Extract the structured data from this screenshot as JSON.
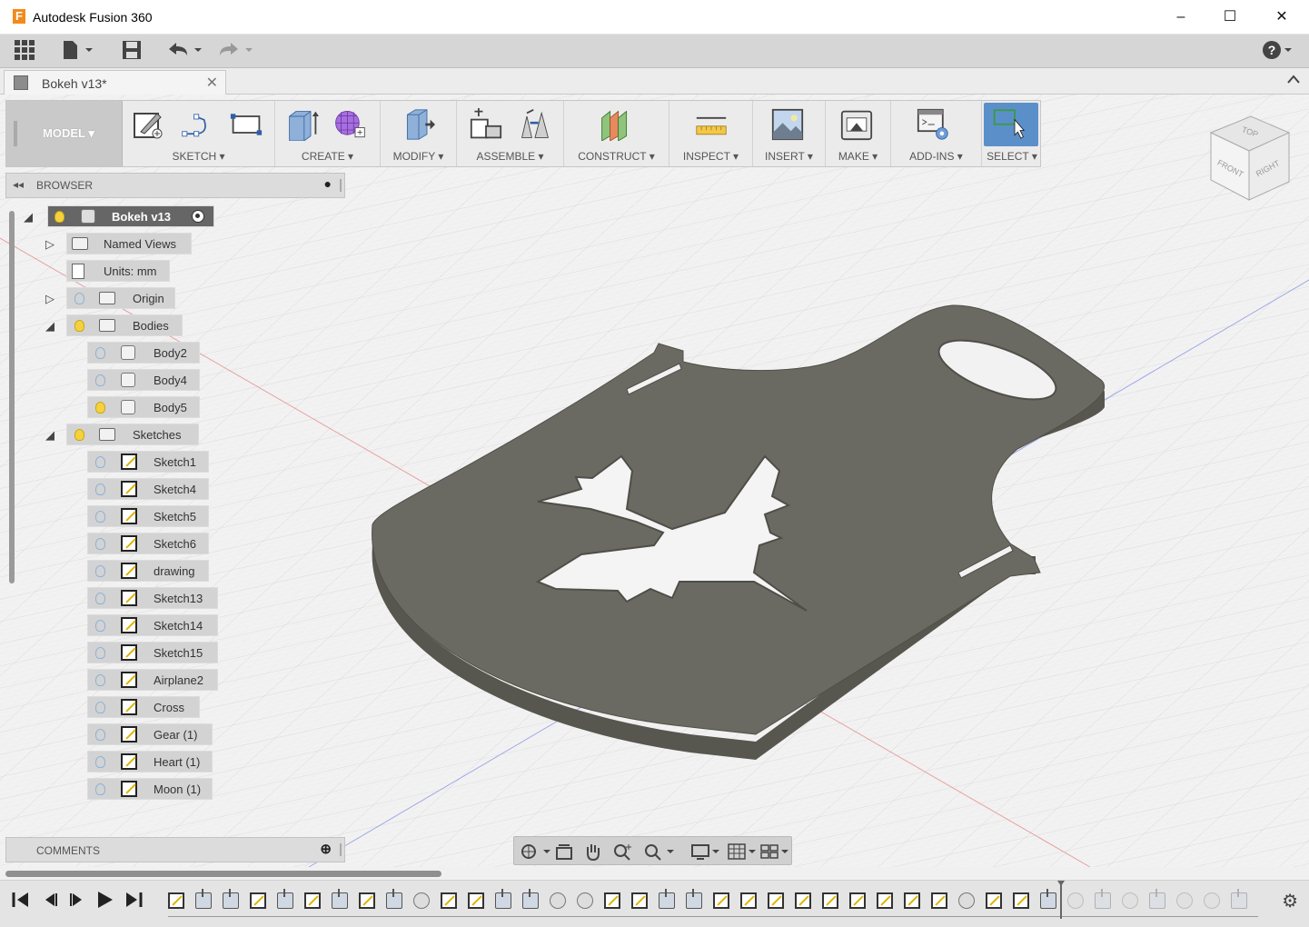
{
  "app": {
    "title": "Autodesk Fusion 360",
    "icon_letter": "F",
    "window_controls": [
      "–",
      "☐",
      "✕"
    ]
  },
  "quick_access": {
    "grid_icon": "grid-icon",
    "file_icon": "file-icon",
    "save_icon": "save-icon",
    "undo_icon": "undo-icon",
    "redo_icon": "redo-icon",
    "help_icon": "help-icon",
    "help_label": "?"
  },
  "document_tab": {
    "label": "Bokeh v13*",
    "close": "✕"
  },
  "toolbar": {
    "workspace": "MODEL ▾",
    "groups": [
      {
        "label": "SKETCH ▾"
      },
      {
        "label": "CREATE ▾"
      },
      {
        "label": "MODIFY ▾"
      },
      {
        "label": "ASSEMBLE ▾"
      },
      {
        "label": "CONSTRUCT ▾"
      },
      {
        "label": "INSPECT ▾"
      },
      {
        "label": "INSERT ▾"
      },
      {
        "label": "MAKE ▾"
      },
      {
        "label": "ADD-INS ▾"
      },
      {
        "label": "SELECT ▾"
      }
    ]
  },
  "viewcube": {
    "top": "TOP",
    "front": "FRONT",
    "right": "RIGHT"
  },
  "browser": {
    "title": "BROWSER",
    "root": "Bokeh v13",
    "named_views": "Named Views",
    "units": "Units: mm",
    "origin": "Origin",
    "bodies": "Bodies",
    "body_items": [
      "Body2",
      "Body4",
      "Body5"
    ],
    "sketches": "Sketches",
    "sketch_items": [
      "Sketch1",
      "Sketch4",
      "Sketch5",
      "Sketch6",
      "drawing",
      "Sketch13",
      "Sketch14",
      "Sketch15",
      "Airplane2",
      "Cross",
      "Gear (1)",
      "Heart (1)",
      "Moon (1)"
    ]
  },
  "comments": {
    "title": "COMMENTS"
  },
  "colors": {
    "part": "#6b6a62",
    "part_edge": "#57564f",
    "accent_select": "#4f8cc9",
    "bulb_on": "#f5d23d"
  }
}
